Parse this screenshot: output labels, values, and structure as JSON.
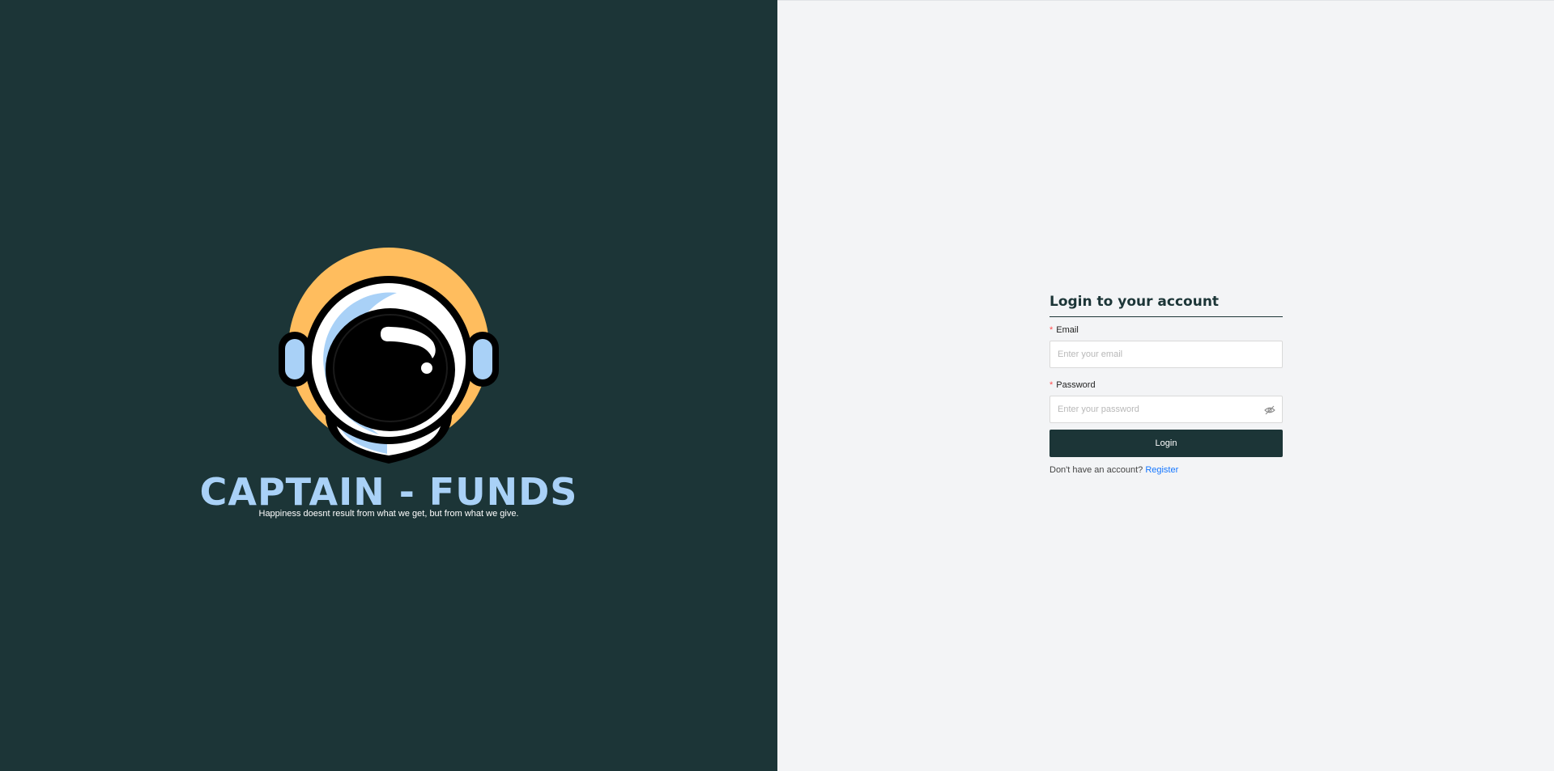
{
  "brand": {
    "title": "CAPTAIN - FUNDS",
    "tagline": "Happiness doesnt result from what we get, but from what we give.",
    "logo_icon": "astronaut-helmet-icon",
    "colors": {
      "panel": "#1c3537",
      "title": "#a9d1f7",
      "sun": "#ffbd5e"
    }
  },
  "login": {
    "heading": "Login to your account",
    "email_label": "Email",
    "email_placeholder": "Enter your email",
    "email_value": "",
    "password_label": "Password",
    "password_placeholder": "Enter your password",
    "password_value": "",
    "required_marker": "*",
    "toggle_icon": "eye-invisible-icon",
    "button_label": "Login",
    "register_prompt": "Don't have an account?",
    "register_link": "Register",
    "colors": {
      "button": "#1c3537",
      "link": "#1677ff",
      "required": "#ff4d4f"
    }
  }
}
